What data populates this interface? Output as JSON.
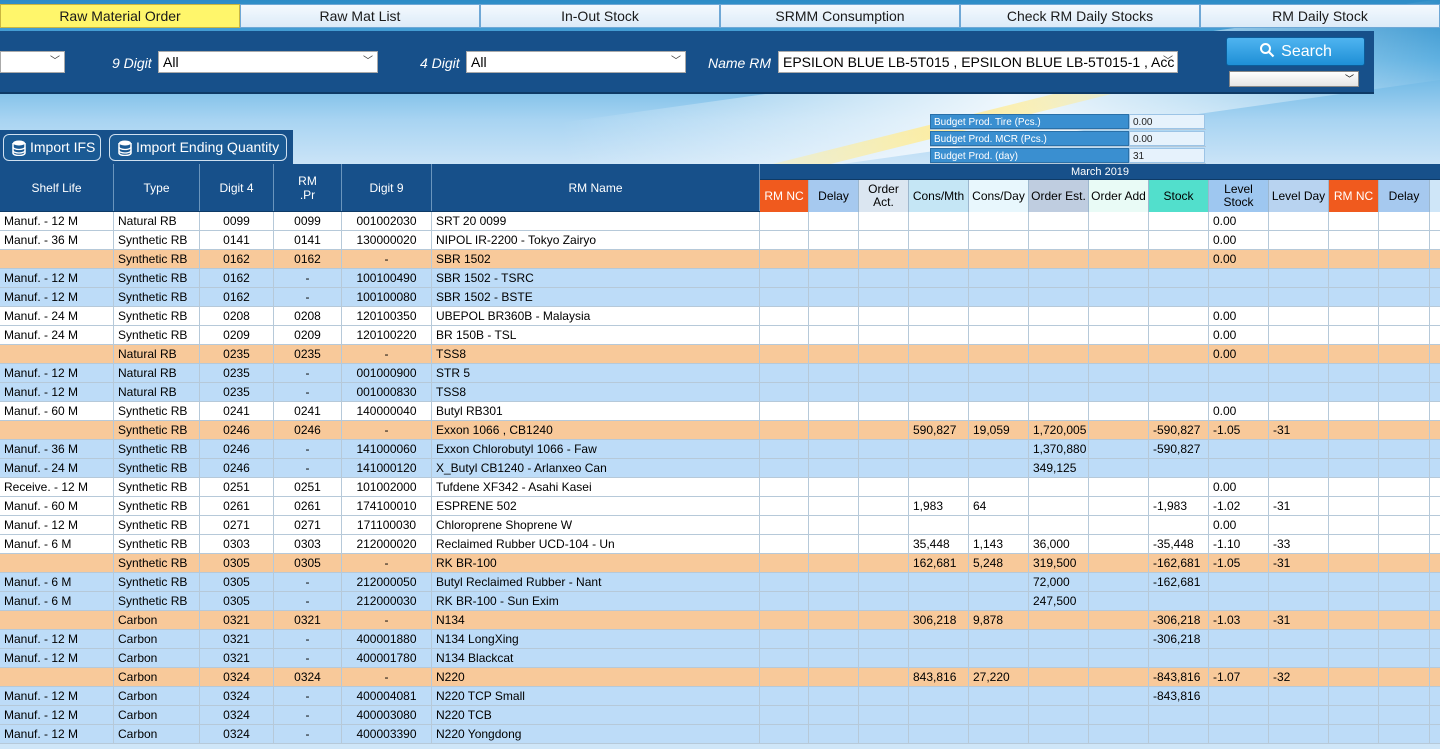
{
  "tabs": [
    "Raw Material Order",
    "Raw Mat List",
    "In-Out Stock",
    "SRMM Consumption",
    "Check RM Daily Stocks",
    "RM Daily Stock"
  ],
  "filters": {
    "digit9_label": "9 Digit",
    "digit9_value": "All",
    "digit4_label": "4 Digit",
    "digit4_value": "All",
    "name_label": "Name RM",
    "name_value": "EPSILON BLUE LB-5T015 ,  EPSILON BLUE LB-5T015-1 , Acc",
    "search_label": "Search"
  },
  "import": {
    "ifs_label": "Import IFS",
    "ending_label": "Import Ending Quantity"
  },
  "budget": [
    {
      "k": "Budget Prod. Tire (Pcs.)",
      "v": "0.00"
    },
    {
      "k": "Budget Prod. MCR (Pcs.)",
      "v": "0.00"
    },
    {
      "k": "Budget Prod. (day)",
      "v": "31"
    }
  ],
  "left_headers": [
    "Shelf Life",
    "Type",
    "Digit 4",
    "RM .Pr",
    "Digit 9",
    "RM Name"
  ],
  "month_label": "March 2019",
  "right_headers": [
    "RM NC",
    "Delay",
    "Order Act.",
    "Cons/Mth",
    "Cons/Day",
    "Order Est.",
    "Order Add",
    "Stock",
    "Level Stock",
    "Level Day",
    "RM NC",
    "Delay"
  ],
  "rows": [
    {
      "s": "w",
      "c": [
        "Manuf. - 12 M",
        "Natural RB",
        "0099",
        "0099",
        "001002030",
        "SRT 20 0099"
      ],
      "r": [
        "",
        "",
        "",
        "",
        "",
        "",
        "",
        "",
        "0.00",
        "",
        "",
        ""
      ]
    },
    {
      "s": "w",
      "c": [
        "Manuf. - 36 M",
        "Synthetic RB",
        "0141",
        "0141",
        "130000020",
        "NIPOL IR-2200 - Tokyo Zairyo"
      ],
      "r": [
        "",
        "",
        "",
        "",
        "",
        "",
        "",
        "",
        "0.00",
        "",
        "",
        ""
      ]
    },
    {
      "s": "o",
      "c": [
        "",
        "Synthetic RB",
        "0162",
        "0162",
        "-",
        "SBR 1502"
      ],
      "r": [
        "",
        "",
        "",
        "",
        "",
        "",
        "",
        "",
        "0.00",
        "",
        "",
        ""
      ]
    },
    {
      "s": "b",
      "c": [
        "Manuf. - 12 M",
        "Synthetic RB",
        "0162",
        "-",
        "100100490",
        "SBR 1502 - TSRC"
      ],
      "r": [
        "",
        "",
        "",
        "",
        "",
        "",
        "",
        "",
        "",
        "",
        "",
        ""
      ]
    },
    {
      "s": "b",
      "c": [
        "Manuf. - 12 M",
        "Synthetic RB",
        "0162",
        "-",
        "100100080",
        "SBR 1502 - BSTE"
      ],
      "r": [
        "",
        "",
        "",
        "",
        "",
        "",
        "",
        "",
        "",
        "",
        "",
        ""
      ]
    },
    {
      "s": "w",
      "c": [
        "Manuf. - 24 M",
        "Synthetic RB",
        "0208",
        "0208",
        "120100350",
        "UBEPOL BR360B - Malaysia"
      ],
      "r": [
        "",
        "",
        "",
        "",
        "",
        "",
        "",
        "",
        "0.00",
        "",
        "",
        ""
      ]
    },
    {
      "s": "w",
      "c": [
        "Manuf. - 24 M",
        "Synthetic RB",
        "0209",
        "0209",
        "120100220",
        "BR 150B - TSL"
      ],
      "r": [
        "",
        "",
        "",
        "",
        "",
        "",
        "",
        "",
        "0.00",
        "",
        "",
        ""
      ]
    },
    {
      "s": "o",
      "c": [
        "",
        "Natural RB",
        "0235",
        "0235",
        "-",
        "TSS8"
      ],
      "r": [
        "",
        "",
        "",
        "",
        "",
        "",
        "",
        "",
        "0.00",
        "",
        "",
        ""
      ]
    },
    {
      "s": "b",
      "c": [
        "Manuf. - 12 M",
        "Natural RB",
        "0235",
        "-",
        "001000900",
        "STR 5"
      ],
      "r": [
        "",
        "",
        "",
        "",
        "",
        "",
        "",
        "",
        "",
        "",
        "",
        ""
      ]
    },
    {
      "s": "b",
      "c": [
        "Manuf. - 12 M",
        "Natural RB",
        "0235",
        "-",
        "001000830",
        " TSS8"
      ],
      "r": [
        "",
        "",
        "",
        "",
        "",
        "",
        "",
        "",
        "",
        "",
        "",
        ""
      ]
    },
    {
      "s": "w",
      "c": [
        "Manuf. - 60 M",
        "Synthetic RB",
        "0241",
        "0241",
        "140000040",
        "Butyl RB301"
      ],
      "r": [
        "",
        "",
        "",
        "",
        "",
        "",
        "",
        "",
        "0.00",
        "",
        "",
        ""
      ]
    },
    {
      "s": "o",
      "c": [
        "",
        "Synthetic RB",
        "0246",
        "0246",
        "-",
        "Exxon 1066 , CB1240"
      ],
      "r": [
        "",
        "",
        "",
        "590,827",
        "19,059",
        "1,720,005",
        "",
        "-590,827",
        "-1.05",
        "-31",
        "",
        ""
      ]
    },
    {
      "s": "b",
      "c": [
        "Manuf. - 36 M",
        "Synthetic RB",
        "0246",
        "-",
        "141000060",
        "Exxon Chlorobutyl 1066  - Faw"
      ],
      "r": [
        "",
        "",
        "",
        "",
        "",
        "1,370,880",
        "",
        "-590,827",
        "",
        "",
        "",
        ""
      ]
    },
    {
      "s": "b",
      "c": [
        "Manuf. - 24 M",
        "Synthetic RB",
        "0246",
        "-",
        "141000120",
        "X_Butyl CB1240 - Arlanxeo Can"
      ],
      "r": [
        "",
        "",
        "",
        "",
        "",
        "349,125",
        "",
        "",
        "",
        "",
        "",
        ""
      ]
    },
    {
      "s": "w",
      "c": [
        "Receive. - 12 M",
        "Synthetic RB",
        "0251",
        "0251",
        "101002000",
        "Tufdene XF342  - Asahi Kasei"
      ],
      "r": [
        "",
        "",
        "",
        "",
        "",
        "",
        "",
        "",
        "0.00",
        "",
        "",
        ""
      ]
    },
    {
      "s": "w",
      "c": [
        "Manuf. - 60 M",
        "Synthetic RB",
        "0261",
        "0261",
        "174100010",
        "ESPRENE 502"
      ],
      "r": [
        "",
        "",
        "",
        "1,983",
        "64",
        "",
        "",
        "-1,983",
        "-1.02",
        "-31",
        "",
        ""
      ]
    },
    {
      "s": "w",
      "c": [
        "Manuf. - 12 M",
        "Synthetic RB",
        "0271",
        "0271",
        "171100030",
        "Chloroprene Shoprene W"
      ],
      "r": [
        "",
        "",
        "",
        "",
        "",
        "",
        "",
        "",
        "0.00",
        "",
        "",
        ""
      ]
    },
    {
      "s": "w",
      "c": [
        "Manuf. - 6 M",
        "Synthetic RB",
        "0303",
        "0303",
        "212000020",
        "Reclaimed Rubber UCD-104 - Un"
      ],
      "r": [
        "",
        "",
        "",
        "35,448",
        "1,143",
        "36,000",
        "",
        "-35,448",
        "-1.10",
        "-33",
        "",
        ""
      ]
    },
    {
      "s": "o",
      "c": [
        "",
        "Synthetic RB",
        "0305",
        "0305",
        "-",
        "RK BR-100"
      ],
      "r": [
        "",
        "",
        "",
        "162,681",
        "5,248",
        "319,500",
        "",
        "-162,681",
        "-1.05",
        "-31",
        "",
        ""
      ]
    },
    {
      "s": "b",
      "c": [
        "Manuf. - 6 M",
        "Synthetic RB",
        "0305",
        "-",
        "212000050",
        "Butyl Reclaimed Rubber - Nant"
      ],
      "r": [
        "",
        "",
        "",
        "",
        "",
        "72,000",
        "",
        "-162,681",
        "",
        "",
        "",
        ""
      ]
    },
    {
      "s": "b",
      "c": [
        "Manuf. - 6 M",
        "Synthetic RB",
        "0305",
        "-",
        "212000030",
        "RK BR-100 - Sun Exim"
      ],
      "r": [
        "",
        "",
        "",
        "",
        "",
        "247,500",
        "",
        "",
        "",
        "",
        "",
        ""
      ]
    },
    {
      "s": "o",
      "c": [
        "",
        "Carbon",
        "0321",
        "0321",
        "-",
        "N134"
      ],
      "r": [
        "",
        "",
        "",
        "306,218",
        "9,878",
        "",
        "",
        "-306,218",
        "-1.03",
        "-31",
        "",
        ""
      ]
    },
    {
      "s": "b",
      "c": [
        "Manuf. - 12 M",
        "Carbon",
        "0321",
        "-",
        "400001880",
        "N134 LongXing"
      ],
      "r": [
        "",
        "",
        "",
        "",
        "",
        "",
        "",
        "-306,218",
        "",
        "",
        "",
        ""
      ]
    },
    {
      "s": "b",
      "c": [
        "Manuf. - 12 M",
        "Carbon",
        "0321",
        "-",
        "400001780",
        "N134 Blackcat"
      ],
      "r": [
        "",
        "",
        "",
        "",
        "",
        "",
        "",
        "",
        "",
        "",
        "",
        ""
      ]
    },
    {
      "s": "o",
      "c": [
        "",
        "Carbon",
        "0324",
        "0324",
        "-",
        "N220"
      ],
      "r": [
        "",
        "",
        "",
        "843,816",
        "27,220",
        "",
        "",
        "-843,816",
        "-1.07",
        "-32",
        "",
        ""
      ]
    },
    {
      "s": "b",
      "c": [
        "Manuf. - 12 M",
        "Carbon",
        "0324",
        "-",
        "400004081",
        "N220 TCP Small"
      ],
      "r": [
        "",
        "",
        "",
        "",
        "",
        "",
        "",
        "-843,816",
        "",
        "",
        "",
        ""
      ]
    },
    {
      "s": "b",
      "c": [
        "Manuf. - 12 M",
        "Carbon",
        "0324",
        "-",
        "400003080",
        "N220        TCB"
      ],
      "r": [
        "",
        "",
        "",
        "",
        "",
        "",
        "",
        "",
        "",
        "",
        "",
        ""
      ]
    },
    {
      "s": "b",
      "c": [
        "Manuf. - 12 M",
        "Carbon",
        "0324",
        "-",
        "400003390",
        "N220        Yongdong"
      ],
      "r": [
        "",
        "",
        "",
        "",
        "",
        "",
        "",
        "",
        "",
        "",
        "",
        ""
      ]
    }
  ]
}
